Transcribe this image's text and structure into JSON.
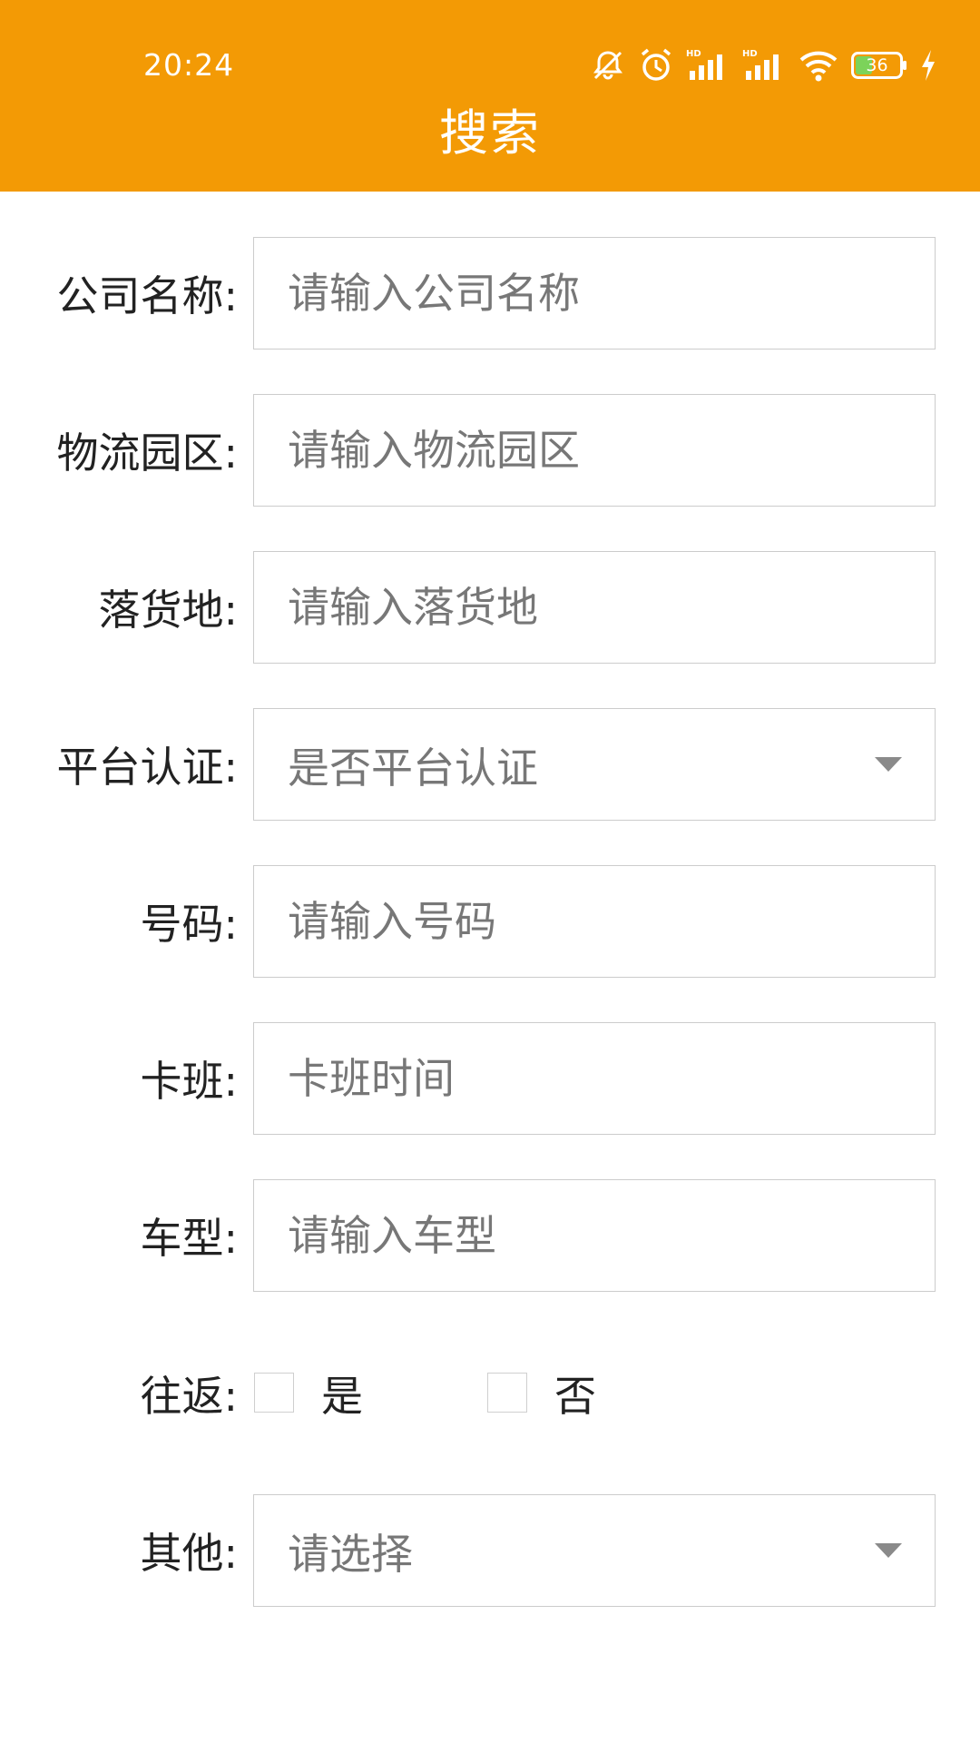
{
  "status_bar": {
    "time": "20:24",
    "battery": "36",
    "icons": [
      "mute-icon",
      "alarm-icon",
      "signal-hd-icon",
      "signal-hd-icon",
      "wifi-icon",
      "battery-icon",
      "charging-icon"
    ]
  },
  "header": {
    "title": "搜索",
    "color": "#f39a05"
  },
  "form": {
    "company": {
      "label": "公司名称:",
      "placeholder": "请输入公司名称"
    },
    "park": {
      "label": "物流园区:",
      "placeholder": "请输入物流园区"
    },
    "destination": {
      "label": "落货地:",
      "placeholder": "请输入落货地"
    },
    "certified": {
      "label": "平台认证:",
      "placeholder": "是否平台认证"
    },
    "number": {
      "label": "号码:",
      "placeholder": "请输入号码"
    },
    "schedule": {
      "label": "卡班:",
      "placeholder": "卡班时间"
    },
    "vehicle": {
      "label": "车型:",
      "placeholder": "请输入车型"
    },
    "round_trip": {
      "label": "往返:",
      "yes": "是",
      "no": "否"
    },
    "other": {
      "label": "其他:",
      "placeholder": "请选择"
    }
  }
}
